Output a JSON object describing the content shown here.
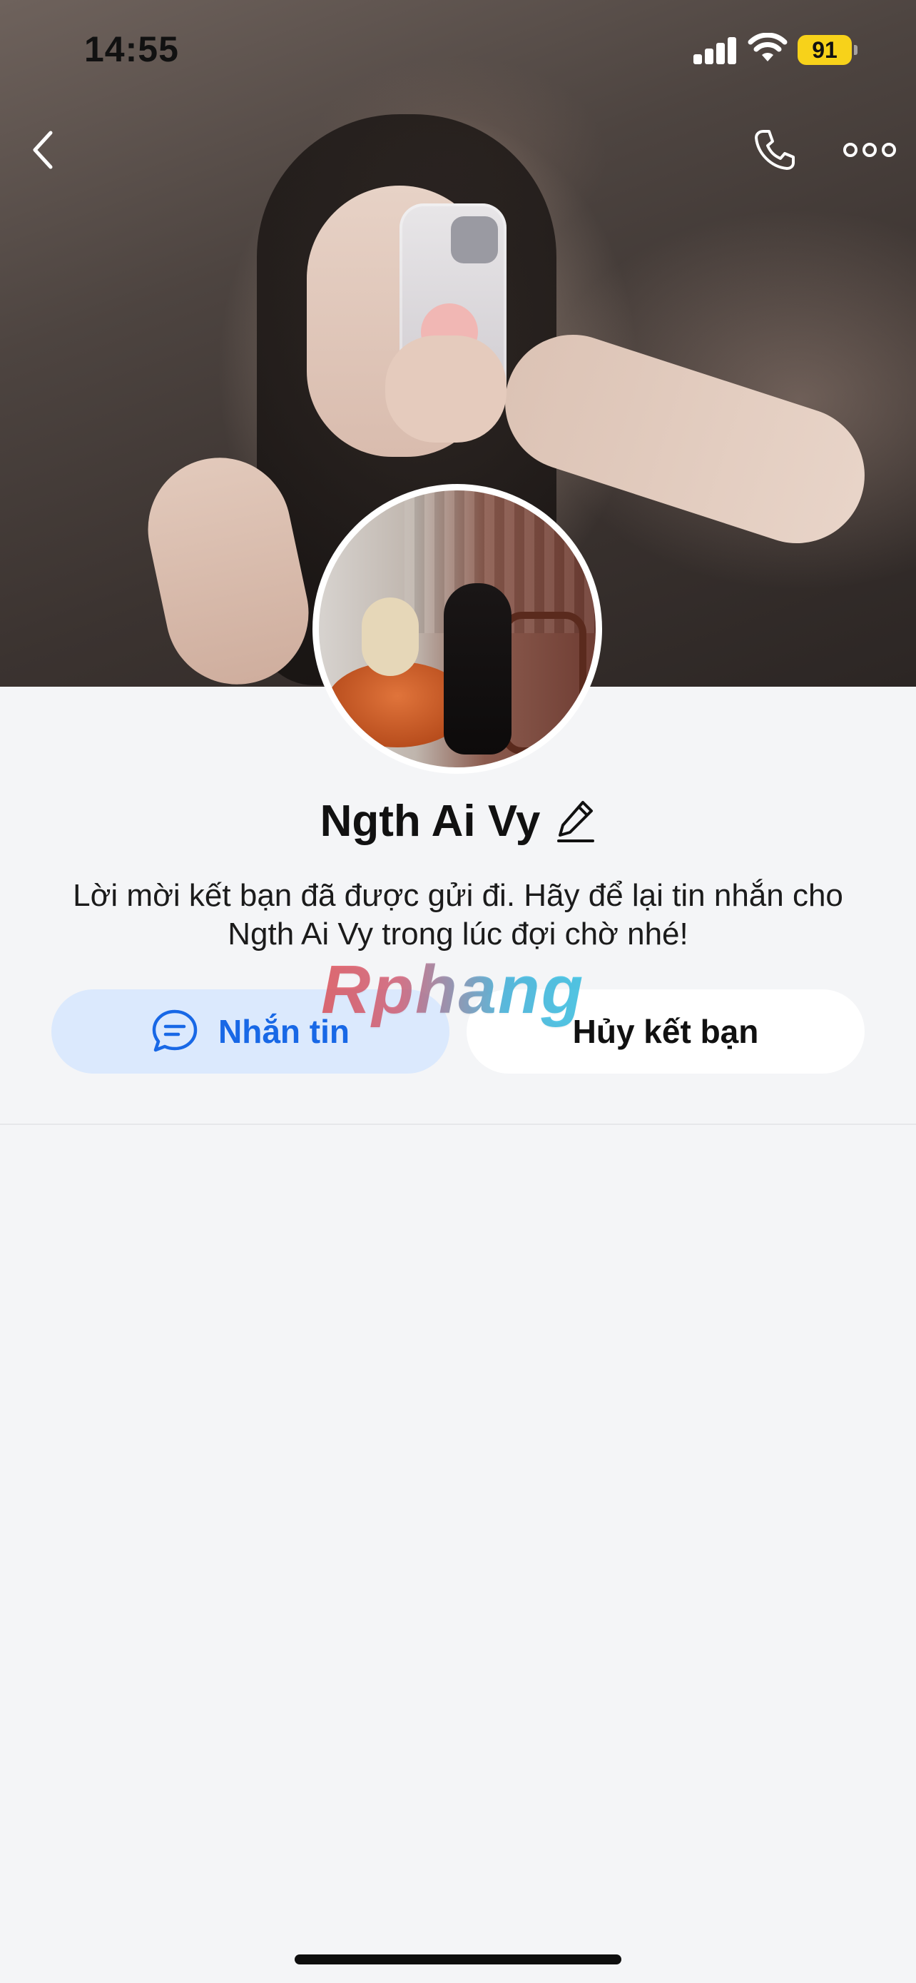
{
  "status_bar": {
    "time": "14:55",
    "battery_level": "91"
  },
  "nav": {
    "back_icon": "chevron-left-icon",
    "call_icon": "phone-icon",
    "more_icon": "ellipsis-icon"
  },
  "profile": {
    "name": "Ngth Ai Vy",
    "edit_icon": "pencil-icon",
    "note": "Lời mời kết bạn đã được gửi đi. Hãy để lại tin nhắn cho Ngth Ai Vy trong lúc đợi chờ nhé!"
  },
  "actions": {
    "message_label": "Nhắn tin",
    "message_icon": "chat-bubble-icon",
    "unfriend_label": "Hủy kết bạn"
  },
  "watermark": "Rphang",
  "colors": {
    "accent": "#1868e6",
    "accent_soft": "#dbe9fd",
    "battery": "#f7d21a",
    "background": "#f4f5f7"
  }
}
